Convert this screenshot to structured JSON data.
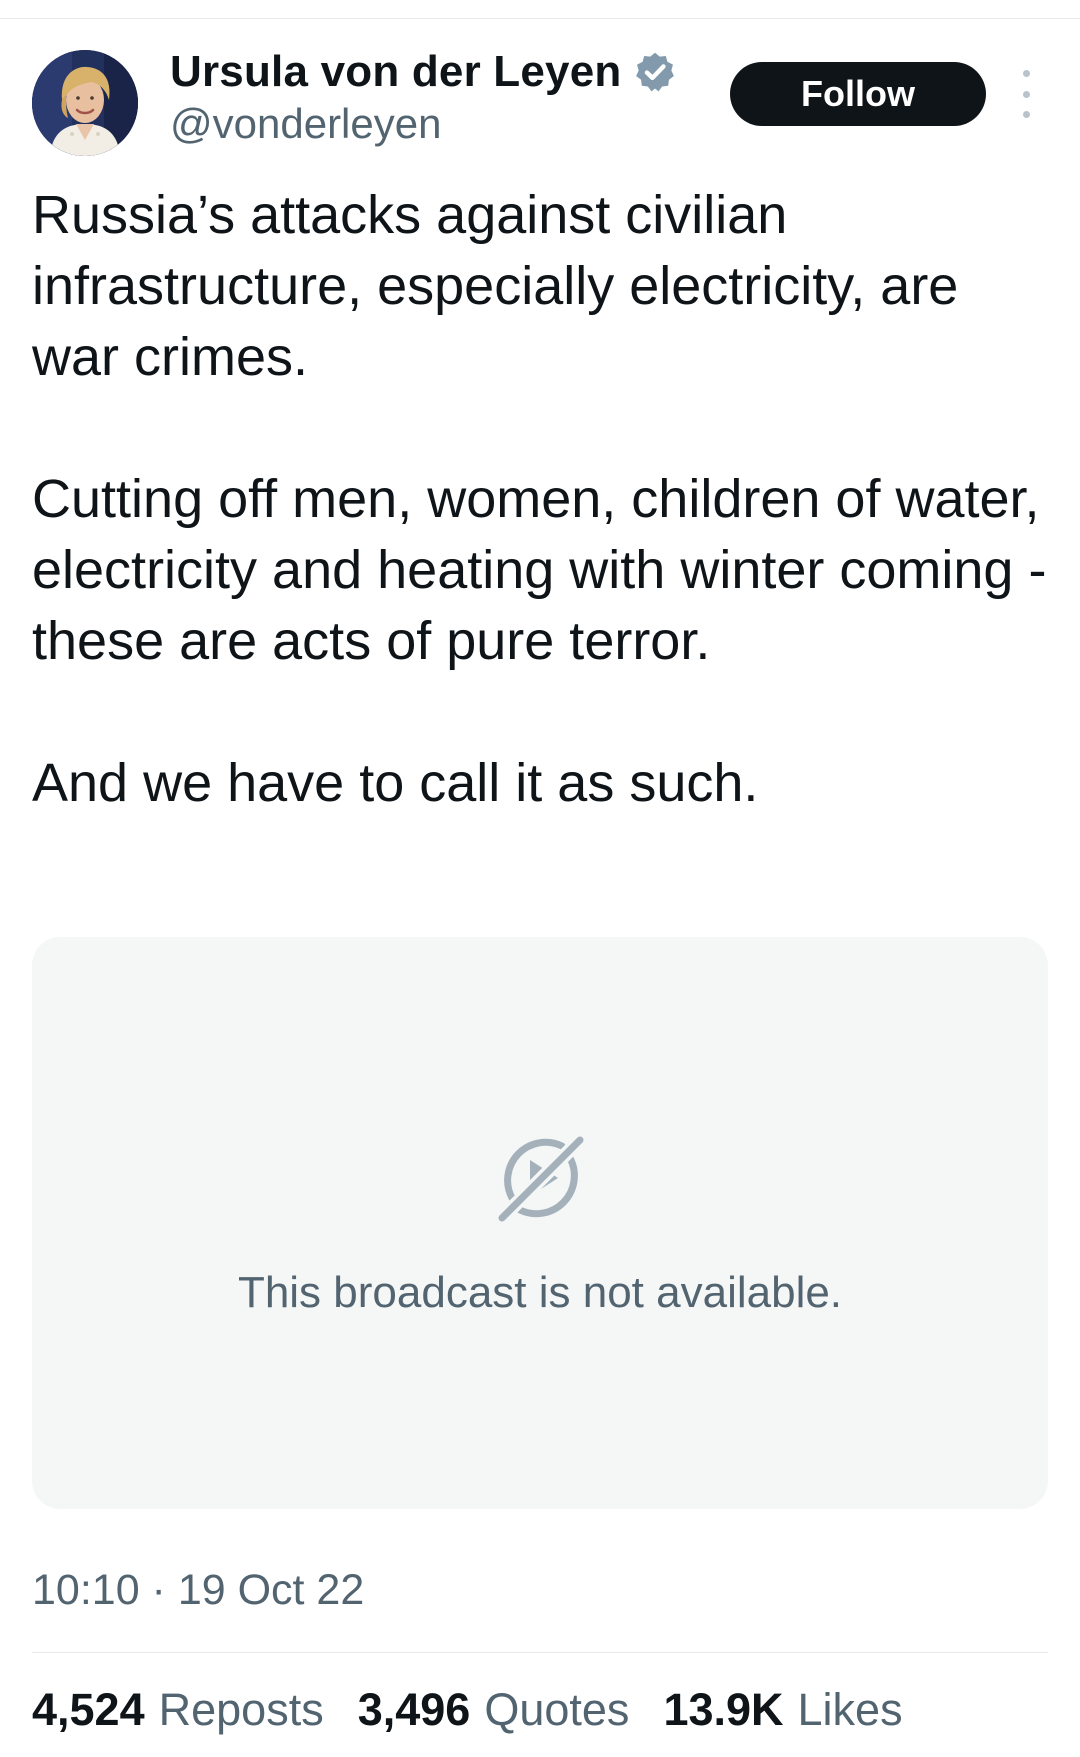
{
  "author": {
    "display_name": "Ursula von der Leyen",
    "handle": "@vonderleyen",
    "verified": true,
    "verified_badge_color": "#829aab",
    "avatar_icon": "profile-photo"
  },
  "actions": {
    "follow_label": "Follow",
    "more_icon": "more-vertical-icon"
  },
  "tweet": {
    "paragraphs": [
      "Russia’s attacks against civilian infrastructure, especially electricity, are war crimes.",
      "Cutting off men, women, children of water, electricity and heating with winter coming - these are acts of pure terror.",
      "And we have to call it as such."
    ]
  },
  "media": {
    "icon": "broadcast-unavailable-icon",
    "message": "This broadcast is not available."
  },
  "timestamp": "10:10 · 19 Oct 22",
  "stats": {
    "reposts": {
      "value": "4,524",
      "label": "Reposts"
    },
    "quotes": {
      "value": "3,496",
      "label": "Quotes"
    },
    "likes": {
      "value": "13.9K",
      "label": "Likes"
    }
  },
  "colors": {
    "text_primary": "#0f1419",
    "text_secondary": "#536471",
    "follow_bg": "#0f1419",
    "media_bg": "#f5f7f7",
    "divider": "#e7e9ea"
  }
}
